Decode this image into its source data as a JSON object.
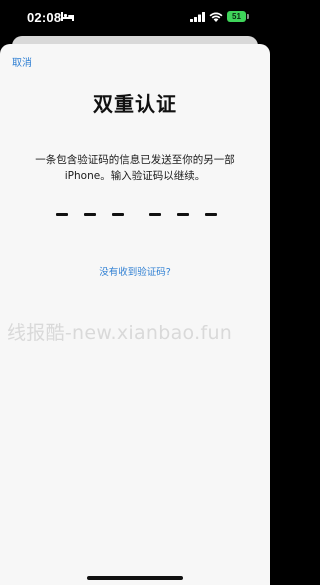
{
  "status_bar": {
    "time": "02:08",
    "battery": "51"
  },
  "sheet": {
    "cancel_label": "取消",
    "title": "双重认证",
    "instruction_line1": "一条包含验证码的信息已发送至你的另一部",
    "instruction_line2": "iPhone。输入验证码以继续。",
    "code_slots": 6,
    "resend_label": "没有收到验证码?"
  },
  "watermark": "线报酷-new.xianbao.fun",
  "colors": {
    "accent": "#2f7fd3",
    "battery": "#3fd45a",
    "sheet_bg": "#f7f7f7",
    "background": "#000000"
  },
  "icons": [
    "bed-icon",
    "signal-icon",
    "wifi-icon",
    "battery-icon"
  ]
}
